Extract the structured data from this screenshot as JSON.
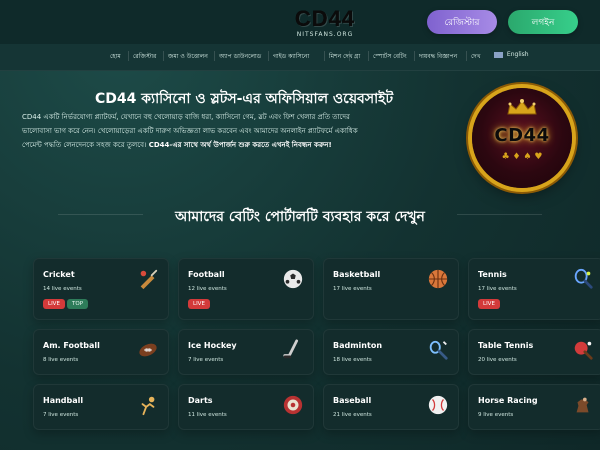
{
  "header": {
    "logo_text": "CD44",
    "logo_sub": "NITSFANS.ORG",
    "login_label": "রেজিস্টার",
    "register_label": "লগইন"
  },
  "nav": {
    "items": [
      "হোম",
      "রেজিস্টার",
      "জমা ও উত্তোলন",
      "অ্যাপ ডাউনলোড",
      "গাইড ক্যাসিনো",
      "মিশন দেখ",
      "গ্রা",
      "স্পোর্টস বেটিং",
      "দায়বদ্ধ বিজ্ঞাপন",
      "দেখ"
    ],
    "lang_label": "English"
  },
  "hero": {
    "title": "CD44 ক্যাসিনো ও স্লটস-এর অফিসিয়াল ওয়েবসাইট",
    "line1": "CD44 একটি নির্ভরযোগ্য প্ল্যাটফর্ম, যেখানে বহু খেলোয়াড় বাজি ধরা, ক্যাসিনো গেম, স্লট এবং ফিশ খেলার প্রতি তাদের",
    "line2": "ভালোবাসা ভাগ করে নেন। খেলোয়াড়েরা একটি দারুণ অভিজ্ঞতা লাভ করবেন এবং আমাদের অনলাইন প্ল্যাটফর্মে একাধিক",
    "line3_normal": "পেমেন্ট পদ্ধতি লেনদেনকে সহজ করে তুলবে।",
    "line3_strong": "CD44-এর সাথে অর্থ উপার্জন শুরু করতে এখনই নিবন্ধন করুন!"
  },
  "badge": {
    "text": "CD44",
    "suits": "♣ ♦ ♠ ♥"
  },
  "section": {
    "title": "আমাদের বেটিং পোর্টালটি ব্যবহার করে দেখুন"
  },
  "sports": [
    {
      "name": "Cricket",
      "events": "14 live events",
      "icon": "cricket-bat-icon",
      "tags": [
        "LIVE",
        "TOP"
      ]
    },
    {
      "name": "Football",
      "events": "12 live events",
      "icon": "football-icon",
      "tags": [
        "LIVE"
      ]
    },
    {
      "name": "Basketball",
      "events": "17 live events",
      "icon": "basketball-icon",
      "tags": []
    },
    {
      "name": "Tennis",
      "events": "17 live events",
      "icon": "tennis-racket-icon",
      "tags": [
        "LIVE"
      ]
    },
    {
      "name": "Am. Football",
      "events": "8 live events",
      "icon": "american-football-icon",
      "tags": []
    },
    {
      "name": "Ice Hockey",
      "events": "7 live events",
      "icon": "hockey-stick-icon",
      "tags": []
    },
    {
      "name": "Badminton",
      "events": "18 live events",
      "icon": "badminton-racket-icon",
      "tags": []
    },
    {
      "name": "Table Tennis",
      "events": "20 live events",
      "icon": "table-tennis-paddle-icon",
      "tags": []
    },
    {
      "name": "Handball",
      "events": "7 live events",
      "icon": "handball-icon",
      "tags": []
    },
    {
      "name": "Darts",
      "events": "11 live events",
      "icon": "dartboard-icon",
      "tags": []
    },
    {
      "name": "Baseball",
      "events": "21 live events",
      "icon": "baseball-icon",
      "tags": []
    },
    {
      "name": "Horse Racing",
      "events": "9 live events",
      "icon": "horse-icon",
      "tags": []
    }
  ],
  "colors": {
    "login_gradient_start": "#7f62cf",
    "register_gradient_start": "#2ba86d",
    "live_tag": "#d33a3a",
    "top_tag": "#2e7c5a",
    "badge_gold": "#d8a41b"
  }
}
